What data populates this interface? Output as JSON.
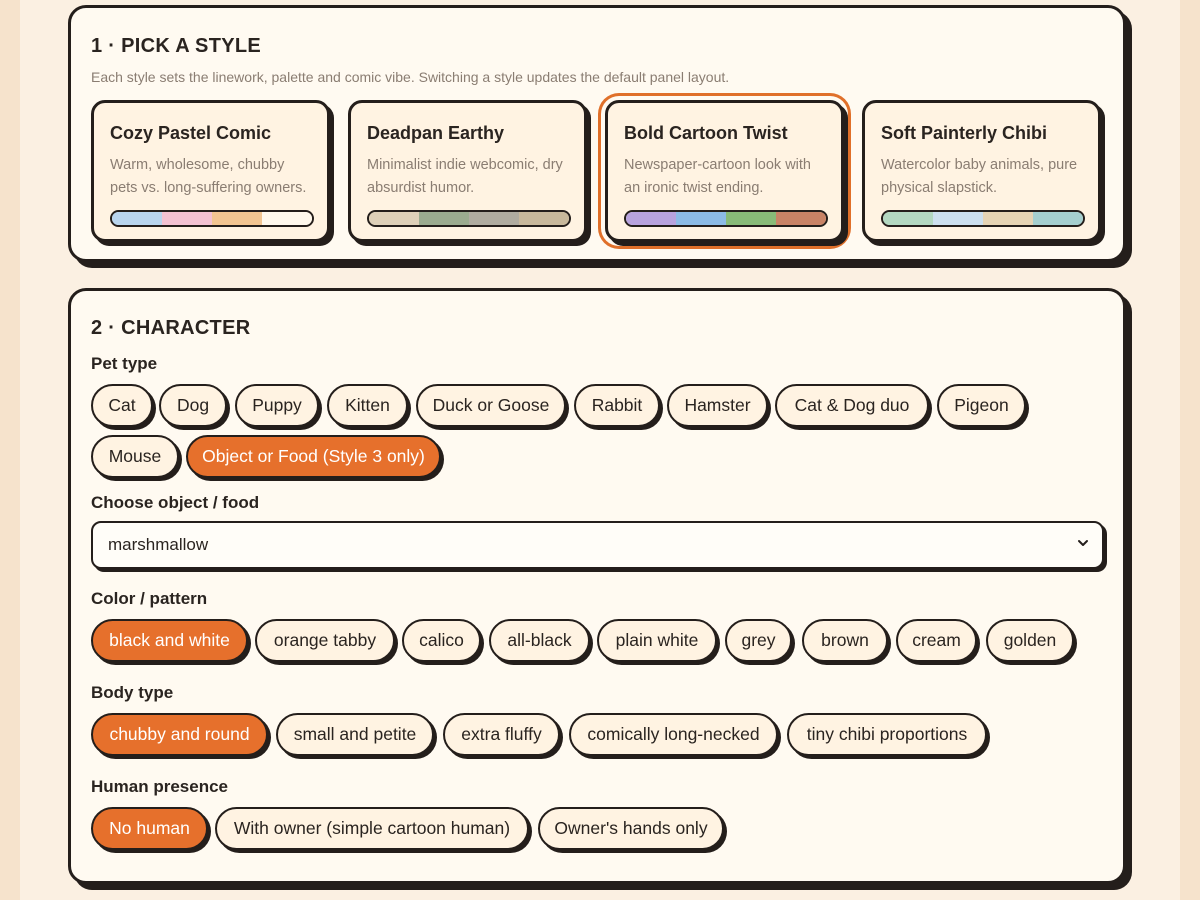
{
  "style_section": {
    "title": "1 · PICK A STYLE",
    "subtitle": "Each style sets the linework, palette and comic vibe. Switching a style updates the default panel layout.",
    "styles": [
      {
        "title": "Cozy Pastel Comic",
        "desc": "Warm, wholesome, chubby pets vs. long-suffering owners.",
        "palette": [
          "#b9d5ee",
          "#f3c2d2",
          "#f2c591",
          "#fff8ec"
        ],
        "selected": false
      },
      {
        "title": "Deadpan Earthy",
        "desc": "Minimalist indie webcomic, dry absurdist humor.",
        "palette": [
          "#ded0b8",
          "#9bab8f",
          "#b0aca0",
          "#c8b89b"
        ],
        "selected": false
      },
      {
        "title": "Bold Cartoon Twist",
        "desc": "Newspaper-cartoon look with an ironic twist ending.",
        "palette": [
          "#b8a3de",
          "#8cbbe6",
          "#88bb78",
          "#c98366"
        ],
        "selected": true
      },
      {
        "title": "Soft Painterly Chibi",
        "desc": "Watercolor baby animals, pure physical slapstick.",
        "palette": [
          "#b3d8c1",
          "#cde0ef",
          "#e6d4b4",
          "#a5cfcf"
        ],
        "selected": false
      }
    ]
  },
  "character_section": {
    "title": "2 · CHARACTER",
    "pet_type": {
      "label": "Pet type",
      "options": [
        "Cat",
        "Dog",
        "Puppy",
        "Kitten",
        "Duck or Goose",
        "Rabbit",
        "Hamster",
        "Cat & Dog duo",
        "Pigeon",
        "Mouse",
        "Object or Food (Style 3 only)"
      ],
      "selected": "Object or Food (Style 3 only)"
    },
    "object": {
      "label": "Choose object / food",
      "value": "marshmallow"
    },
    "color": {
      "label": "Color / pattern",
      "options": [
        "black and white",
        "orange tabby",
        "calico",
        "all-black",
        "plain white",
        "grey",
        "brown",
        "cream",
        "golden"
      ],
      "selected": "black and white"
    },
    "body": {
      "label": "Body type",
      "options": [
        "chubby and round",
        "small and petite",
        "extra fluffy",
        "comically long-necked",
        "tiny chibi proportions"
      ],
      "selected": "chubby and round"
    },
    "human": {
      "label": "Human presence",
      "options": [
        "No human",
        "With owner (simple cartoon human)",
        "Owner's hands only"
      ],
      "selected": "No human"
    }
  },
  "colors": {
    "accent": "#e6702c",
    "ink": "#241e1b",
    "card_bg": "#fffaf1"
  }
}
